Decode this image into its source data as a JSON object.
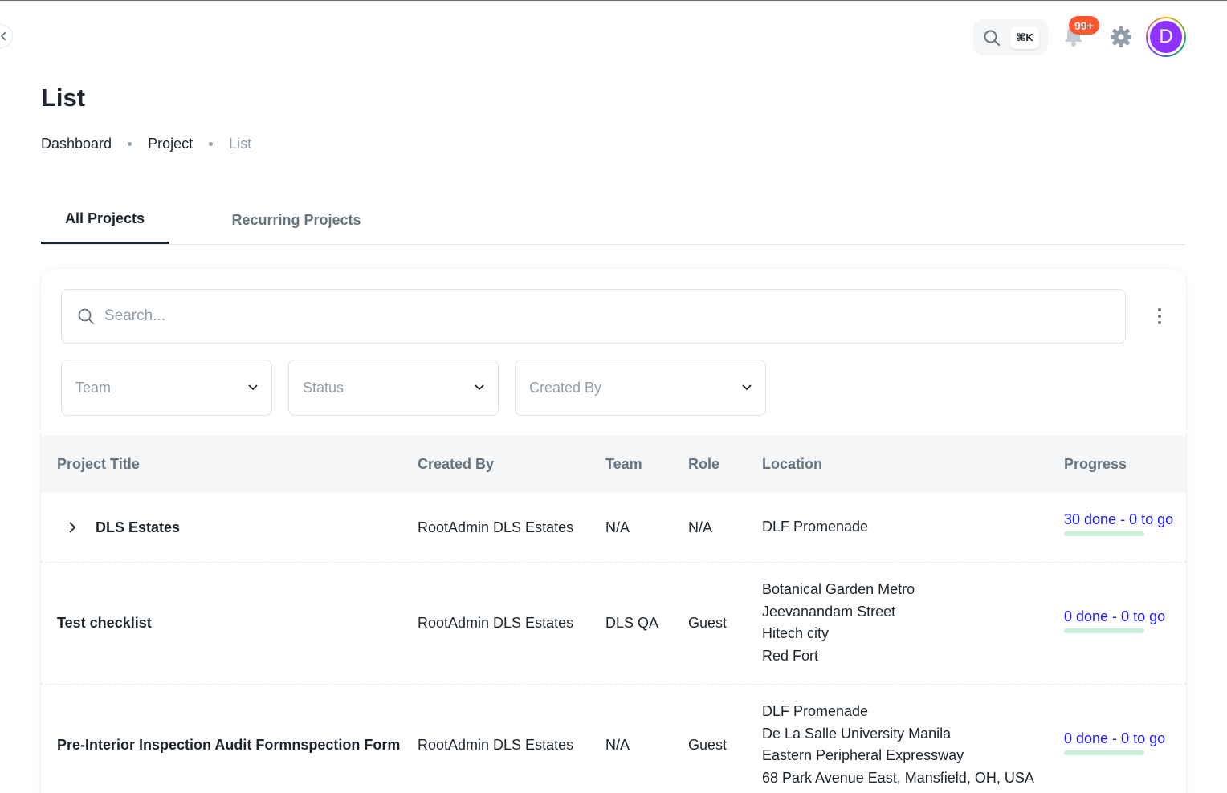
{
  "header": {
    "shortcut": "⌘K",
    "notification_count": "99+",
    "avatar_initial": "D"
  },
  "page": {
    "title": "List",
    "breadcrumbs": [
      "Dashboard",
      "Project",
      "List"
    ]
  },
  "tabs": [
    "All Projects",
    "Recurring Projects"
  ],
  "toolbar": {
    "search_placeholder": "Search...",
    "filters": [
      "Team",
      "Status",
      "Created By"
    ]
  },
  "table": {
    "columns": [
      "Project Title",
      "Created By",
      "Team",
      "Role",
      "Location",
      "Progress"
    ],
    "rows": [
      {
        "title": "DLS Estates",
        "created_by": "RootAdmin DLS Estates",
        "team": "N/A",
        "role": "N/A",
        "locations": [
          "DLF Promenade"
        ],
        "progress": "30 done - 0 to go",
        "progress_done_fraction": 1.0
      },
      {
        "title": "Test checklist",
        "created_by": "RootAdmin DLS Estates",
        "team": "DLS QA",
        "role": "Guest",
        "locations": [
          "Botanical Garden Metro",
          "Jeevanandam Street",
          "Hitech city",
          "Red Fort"
        ],
        "progress": "0 done - 0 to go",
        "progress_done_fraction": 0
      },
      {
        "title": "Pre-Interior Inspection Audit Formnspection Form",
        "created_by": "RootAdmin DLS Estates",
        "team": "N/A",
        "role": "Guest",
        "locations": [
          "DLF Promenade",
          "De La Salle University Manila",
          "Eastern Peripheral Expressway",
          "68 Park Avenue East, Mansfield, OH, USA"
        ],
        "progress": "0 done - 0 to go",
        "progress_done_fraction": 0
      }
    ]
  },
  "colors": {
    "accent_purple": "#8e33ff",
    "badge_red": "#ff5630",
    "progress_text": "#1a1aff",
    "progress_track": "#c8eed6"
  }
}
